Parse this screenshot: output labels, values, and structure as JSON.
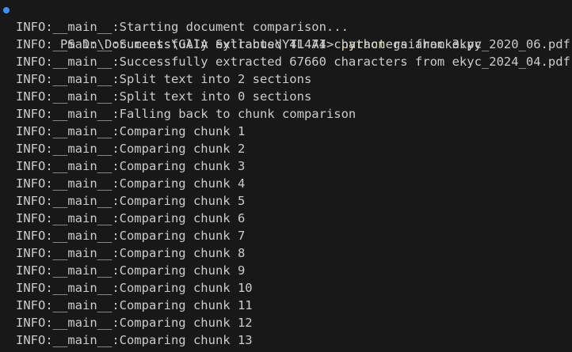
{
  "terminal": {
    "prompt": {
      "path": "PS D:\\Documents\\GAIA Syllabus\\YTL AI> ",
      "command": "python",
      "argument": " gaiahack3.py"
    },
    "output": [
      "INFO:__main__:Starting document comparison...",
      "INFO:__main__:Successfully extracted 41474 characters from ekyc_2020_06.pdf",
      "INFO:__main__:Successfully extracted 67660 characters from ekyc_2024_04.pdf",
      "INFO:__main__:Split text into 2 sections",
      "INFO:__main__:Split text into 0 sections",
      "INFO:__main__:Falling back to chunk comparison",
      "INFO:__main__:Comparing chunk 1",
      "INFO:__main__:Comparing chunk 2",
      "INFO:__main__:Comparing chunk 3",
      "INFO:__main__:Comparing chunk 4",
      "INFO:__main__:Comparing chunk 5",
      "INFO:__main__:Comparing chunk 6",
      "INFO:__main__:Comparing chunk 7",
      "INFO:__main__:Comparing chunk 8",
      "INFO:__main__:Comparing chunk 9",
      "INFO:__main__:Comparing chunk 10",
      "INFO:__main__:Comparing chunk 11",
      "INFO:__main__:Comparing chunk 12",
      "INFO:__main__:Comparing chunk 13"
    ]
  },
  "colors": {
    "background": "#181818",
    "text": "#cccccc",
    "command": "#dcdcaa",
    "prompt_marker": "#3794ff"
  }
}
